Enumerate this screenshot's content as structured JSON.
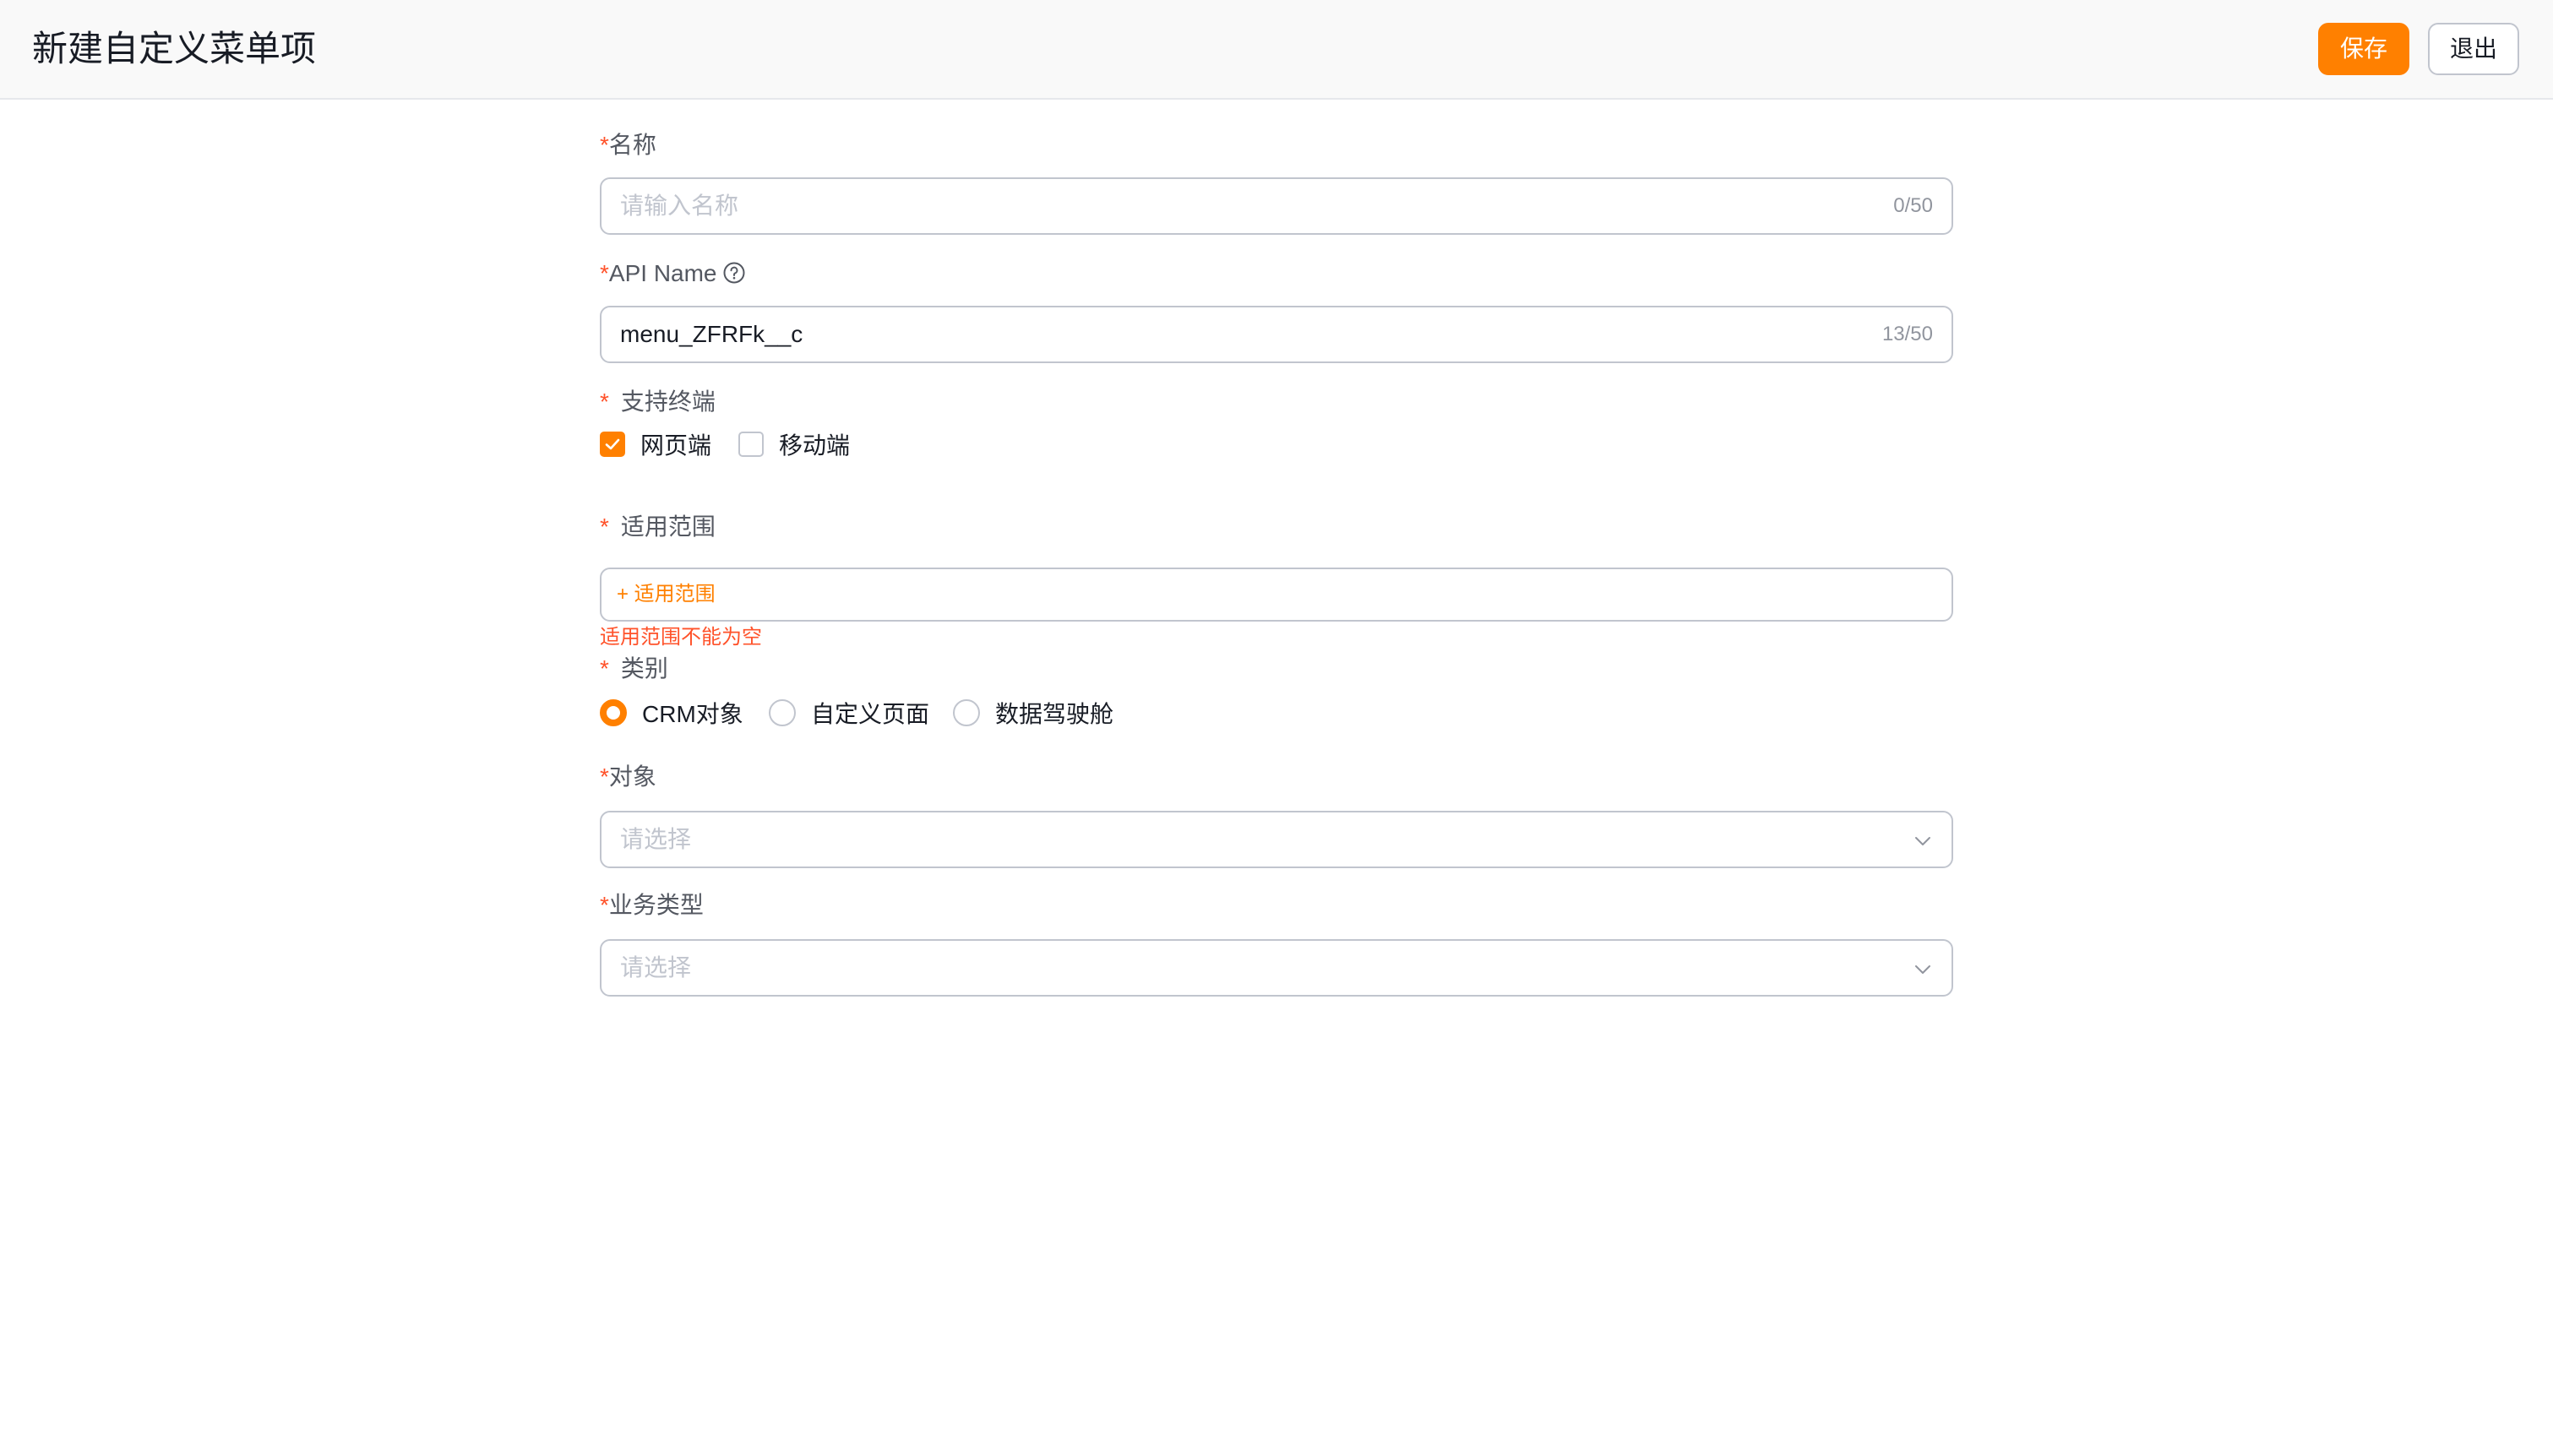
{
  "header": {
    "title": "新建自定义菜单项",
    "save_label": "保存",
    "exit_label": "退出"
  },
  "form": {
    "name": {
      "label": "名称",
      "placeholder": "请输入名称",
      "counter": "0/50"
    },
    "api_name": {
      "label": "API Name",
      "value": "menu_ZFRFk__c",
      "counter": "13/50",
      "help_icon": "help-circle-icon"
    },
    "terminals": {
      "label": "支持终端",
      "options": [
        {
          "label": "网页端",
          "checked": true
        },
        {
          "label": "移动端",
          "checked": false
        }
      ]
    },
    "scope": {
      "label": "适用范围",
      "add_label": "+ 适用范围",
      "error": "适用范围不能为空"
    },
    "category": {
      "label": "类别",
      "options": [
        {
          "label": "CRM对象",
          "selected": true
        },
        {
          "label": "自定义页面",
          "selected": false
        },
        {
          "label": "数据驾驶舱",
          "selected": false
        }
      ]
    },
    "object": {
      "label": "对象",
      "placeholder": "请选择"
    },
    "business_type": {
      "label": "业务类型",
      "placeholder": "请选择"
    }
  },
  "colors": {
    "accent": "#ff8000",
    "error": "#ff522a",
    "border": "#c1c5ce"
  }
}
